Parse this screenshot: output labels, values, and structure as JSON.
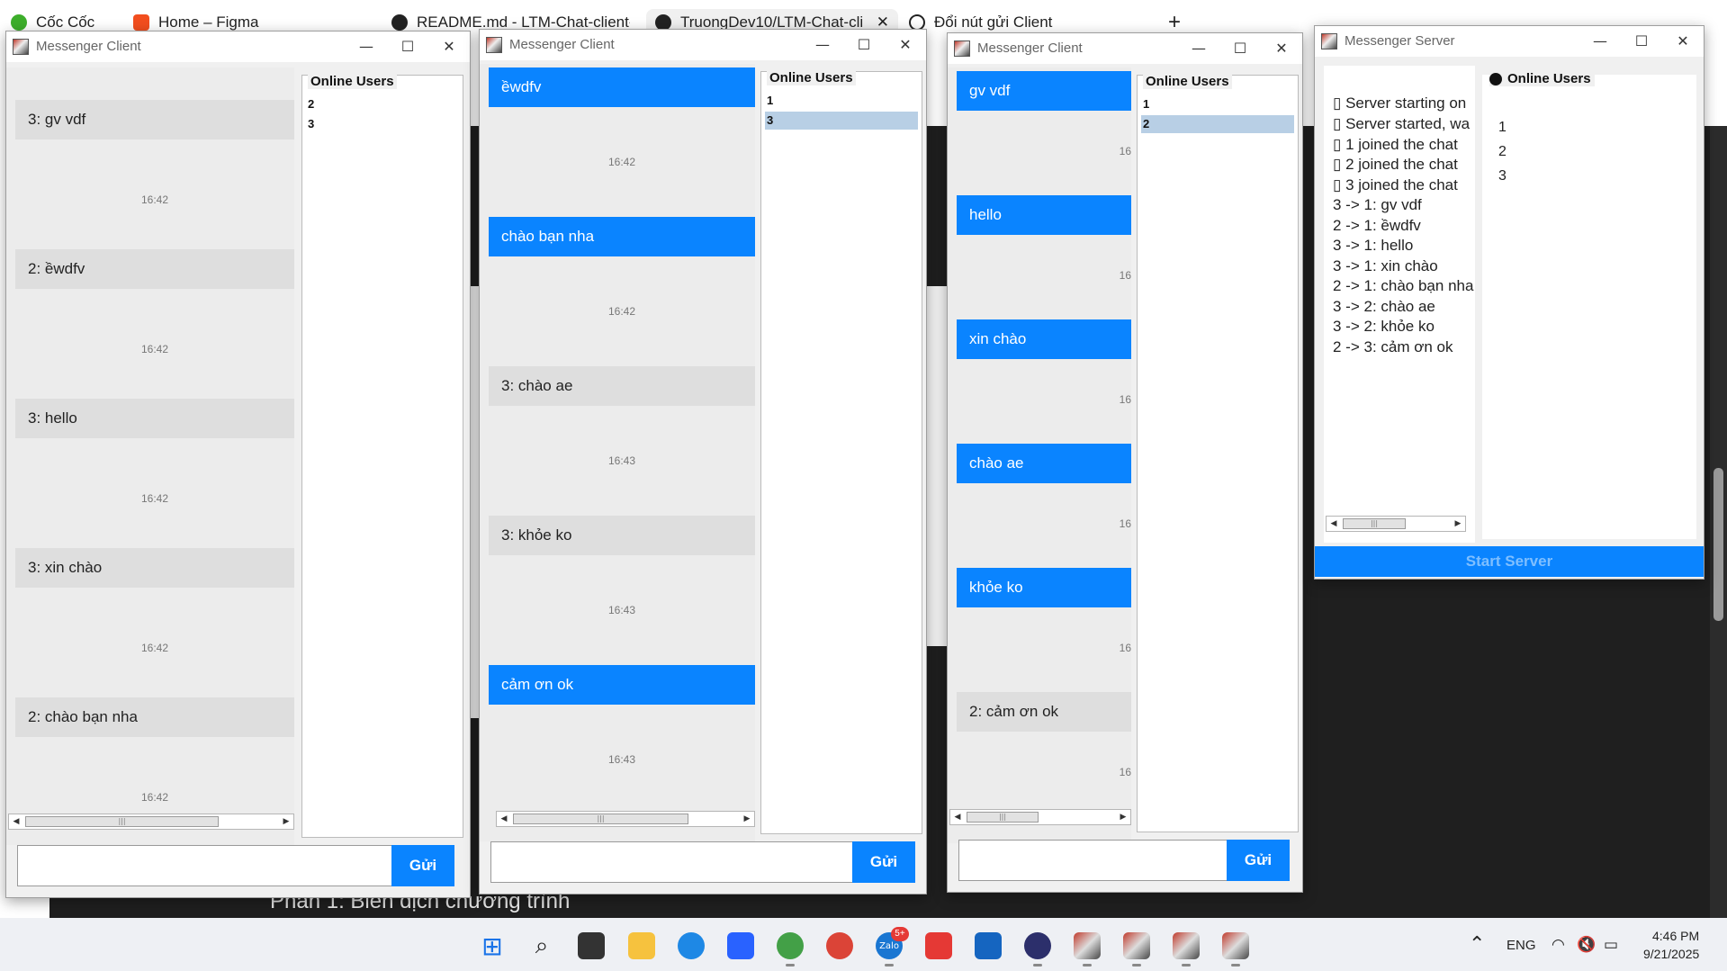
{
  "browser": {
    "tabs": [
      {
        "label": "Cốc Cốc"
      },
      {
        "label": "Home – Figma"
      },
      {
        "label": "README.md - LTM-Chat-client-s"
      },
      {
        "label": "TruongDev10/LTM-Chat-cli"
      },
      {
        "label": "Đổi nút gửi Client"
      }
    ],
    "new_tab_label": "+",
    "page_heading": "Phần 1: Biên dịch chương trình"
  },
  "client1": {
    "title": "Messenger Client",
    "users_title": "Online Users",
    "users": [
      "2",
      "3"
    ],
    "messages": [
      {
        "text": "3: gv vdf",
        "time": "16:42",
        "kind": "in"
      },
      {
        "text": "2: ềwdfv",
        "time": "16:42",
        "kind": "in"
      },
      {
        "text": "3: hello",
        "time": "16:42",
        "kind": "in"
      },
      {
        "text": "3: xin chào",
        "time": "16:42",
        "kind": "in"
      },
      {
        "text": "2: chào bạn nha",
        "time": "16:42",
        "kind": "in"
      }
    ],
    "input_value": "",
    "send_label": "Gửi"
  },
  "client2": {
    "title": "Messenger Client",
    "users_title": "Online Users",
    "users": [
      "1",
      "3"
    ],
    "selected_user": "3",
    "messages": [
      {
        "text": "ềwdfv",
        "time": "16:42",
        "kind": "out"
      },
      {
        "text": "chào bạn nha",
        "time": "16:42",
        "kind": "out"
      },
      {
        "text": "3: chào ae",
        "time": "16:43",
        "kind": "in"
      },
      {
        "text": "3: khỏe ko",
        "time": "16:43",
        "kind": "in"
      },
      {
        "text": "cảm ơn ok",
        "time": "16:43",
        "kind": "out"
      }
    ],
    "input_value": "",
    "send_label": "Gửi"
  },
  "client3": {
    "title": "Messenger Client",
    "users_title": "Online Users",
    "users": [
      "1",
      "2"
    ],
    "selected_user": "2",
    "messages": [
      {
        "text": "gv vdf",
        "time": "16",
        "kind": "out"
      },
      {
        "text": "hello",
        "time": "16",
        "kind": "out"
      },
      {
        "text": "xin chào",
        "time": "16",
        "kind": "out"
      },
      {
        "text": "chào ae",
        "time": "16",
        "kind": "out"
      },
      {
        "text": "khỏe ko",
        "time": "16",
        "kind": "out"
      },
      {
        "text": "2: cảm ơn ok",
        "time": "16",
        "kind": "in"
      }
    ],
    "input_value": "",
    "send_label": "Gửi"
  },
  "server": {
    "title": "Messenger Server",
    "log": [
      "▯ Server starting on",
      "▯ Server started, wa",
      "▯ 1 joined the chat",
      "▯ 2 joined the chat",
      "▯ 3 joined the chat",
      "3 -> 1: gv vdf",
      "2 -> 1: ềwdfv",
      "3 -> 1: hello",
      "3 -> 1: xin chào",
      "2 -> 1: chào bạn nha",
      "3 -> 2: chào ae",
      "3 -> 2: khỏe ko",
      "2 -> 3: cảm ơn ok"
    ],
    "users_title": "Online Users",
    "users": [
      "1",
      "2",
      "3"
    ],
    "start_label": "Start Server"
  },
  "taskbar": {
    "language": "ENG",
    "time": "4:46 PM",
    "date": "9/21/2025",
    "zalo_badge": "5+"
  }
}
